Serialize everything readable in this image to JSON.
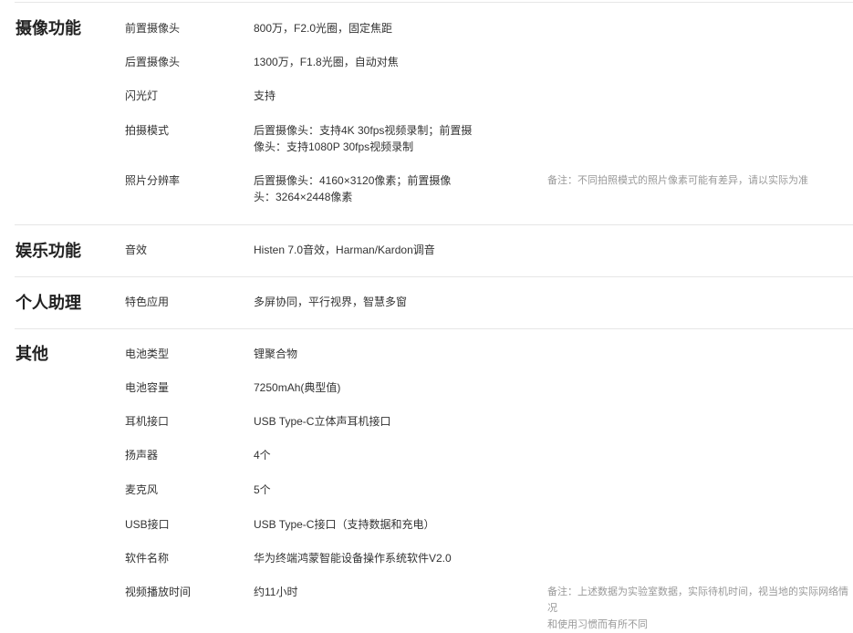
{
  "sections": [
    {
      "title": "摄像功能",
      "rows": [
        {
          "label": "前置摄像头",
          "value": "800万，F2.0光圈，固定焦距"
        },
        {
          "label": "后置摄像头",
          "value": "1300万，F1.8光圈，自动对焦"
        },
        {
          "label": "闪光灯",
          "value": "支持"
        },
        {
          "label": "拍摄模式",
          "value": "后置摄像头：支持4K 30fps视频录制；前置摄\n像头：支持1080P 30fps视频录制"
        },
        {
          "label": "照片分辨率",
          "value": "后置摄像头：4160×3120像素；前置摄像\n头：3264×2448像素",
          "note": "备注：不同拍照模式的照片像素可能有差异，请以实际为准"
        }
      ]
    },
    {
      "title": "娱乐功能",
      "rows": [
        {
          "label": "音效",
          "value": "Histen 7.0音效，Harman/Kardon调音"
        }
      ]
    },
    {
      "title": "个人助理",
      "rows": [
        {
          "label": "特色应用",
          "value": "多屏协同，平行视界，智慧多窗"
        }
      ]
    },
    {
      "title": "其他",
      "rows": [
        {
          "label": "电池类型",
          "value": "锂聚合物"
        },
        {
          "label": "电池容量",
          "value": "7250mAh(典型值)"
        },
        {
          "label": "耳机接口",
          "value": "USB Type-C立体声耳机接口"
        },
        {
          "label": "扬声器",
          "value": "4个"
        },
        {
          "label": "麦克风",
          "value": "5个"
        },
        {
          "label": "USB接口",
          "value": "USB Type-C接口（支持数据和充电）"
        },
        {
          "label": "软件名称",
          "value": "华为终端鸿蒙智能设备操作系统软件V2.0"
        },
        {
          "label": "视频播放时间",
          "value": "约11小时",
          "note": "备注：上述数据为实验室数据，实际待机时间，视当地的实际网络情况\n和使用习惯而有所不同"
        }
      ]
    }
  ]
}
